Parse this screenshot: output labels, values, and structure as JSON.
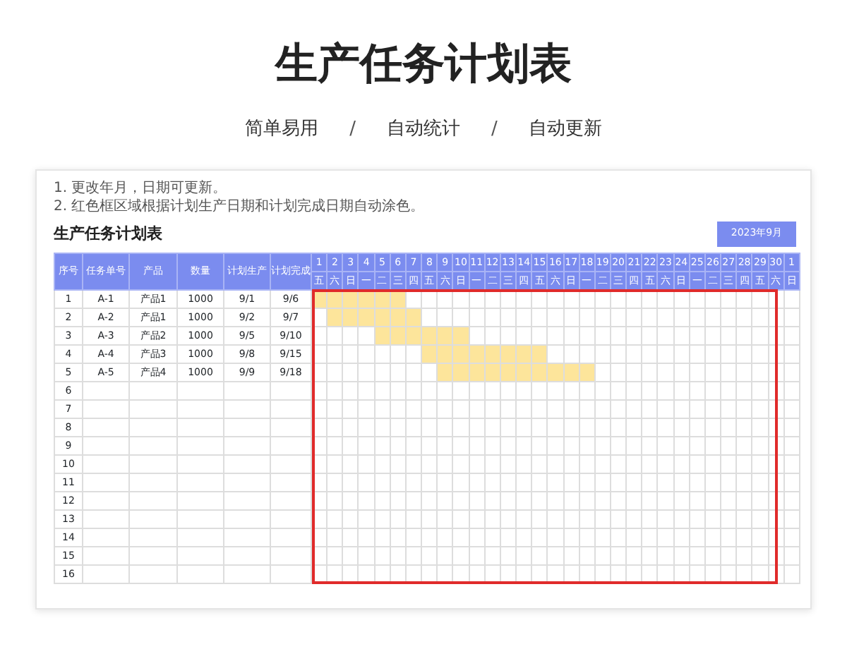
{
  "page_title": "生产任务计划表",
  "features": [
    {
      "label": "简单易用"
    },
    {
      "separator": "/",
      "label": "自动统计"
    },
    {
      "separator": "/",
      "label": "自动更新"
    }
  ],
  "notes": [
    "1. 更改年月，日期可更新。",
    "2. 红色框区域根据计划生产日期和计划完成日期自动涂色。"
  ],
  "sheet": {
    "title": "生产任务计划表",
    "month": "2023年9月",
    "columns": [
      "序号",
      "任务单号",
      "产品",
      "数量",
      "计划生产",
      "计划完成"
    ],
    "days": [
      {
        "day": "1",
        "weekday": "五"
      },
      {
        "day": "2",
        "weekday": "六"
      },
      {
        "day": "3",
        "weekday": "日"
      },
      {
        "day": "4",
        "weekday": "一"
      },
      {
        "day": "5",
        "weekday": "二"
      },
      {
        "day": "6",
        "weekday": "三"
      },
      {
        "day": "7",
        "weekday": "四"
      },
      {
        "day": "8",
        "weekday": "五"
      },
      {
        "day": "9",
        "weekday": "六"
      },
      {
        "day": "10",
        "weekday": "日"
      },
      {
        "day": "11",
        "weekday": "一"
      },
      {
        "day": "12",
        "weekday": "二"
      },
      {
        "day": "13",
        "weekday": "三"
      },
      {
        "day": "14",
        "weekday": "四"
      },
      {
        "day": "15",
        "weekday": "五"
      },
      {
        "day": "16",
        "weekday": "六"
      },
      {
        "day": "17",
        "weekday": "日"
      },
      {
        "day": "18",
        "weekday": "一"
      },
      {
        "day": "19",
        "weekday": "二"
      },
      {
        "day": "20",
        "weekday": "三"
      },
      {
        "day": "21",
        "weekday": "四"
      },
      {
        "day": "22",
        "weekday": "五"
      },
      {
        "day": "23",
        "weekday": "六"
      },
      {
        "day": "24",
        "weekday": "日"
      },
      {
        "day": "25",
        "weekday": "一"
      },
      {
        "day": "26",
        "weekday": "二"
      },
      {
        "day": "27",
        "weekday": "三"
      },
      {
        "day": "28",
        "weekday": "四"
      },
      {
        "day": "29",
        "weekday": "五"
      },
      {
        "day": "30",
        "weekday": "六"
      },
      {
        "day": "1",
        "weekday": "日"
      }
    ],
    "rows": [
      {
        "cells": [
          "1",
          "A-1",
          "产品1",
          "1000",
          "9/1",
          "9/6"
        ]
      },
      {
        "cells": [
          "2",
          "A-2",
          "产品1",
          "1000",
          "9/2",
          "9/7"
        ]
      },
      {
        "cells": [
          "3",
          "A-3",
          "产品2",
          "1000",
          "9/5",
          "9/10"
        ]
      },
      {
        "cells": [
          "4",
          "A-4",
          "产品3",
          "1000",
          "9/8",
          "9/15"
        ]
      },
      {
        "cells": [
          "5",
          "A-5",
          "产品4",
          "1000",
          "9/9",
          "9/18"
        ]
      },
      {
        "cells": [
          "6"
        ]
      },
      {
        "cells": [
          "7"
        ]
      },
      {
        "cells": [
          "8"
        ]
      },
      {
        "cells": [
          "9"
        ]
      },
      {
        "cells": [
          "10"
        ]
      },
      {
        "cells": [
          "11"
        ]
      },
      {
        "cells": [
          "12"
        ]
      },
      {
        "cells": [
          "13"
        ]
      },
      {
        "cells": [
          "14"
        ]
      },
      {
        "cells": [
          "15"
        ]
      },
      {
        "cells": [
          "16"
        ]
      }
    ]
  }
}
